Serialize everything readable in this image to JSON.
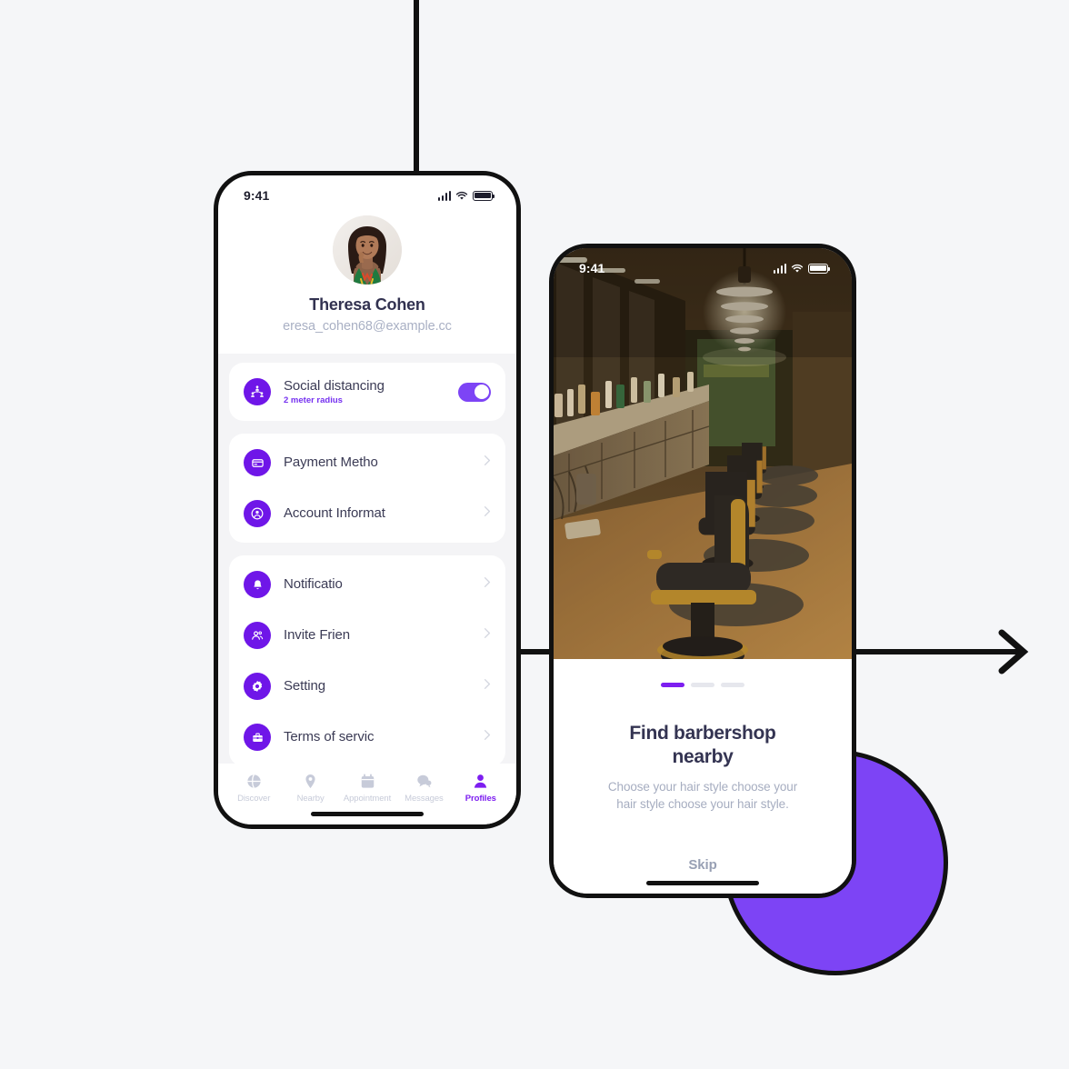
{
  "canvas": {
    "background": "#f5f6f8",
    "accent": "#7d44f5",
    "ink": "#111111"
  },
  "decor": {
    "vertical_line": "vertical-connector",
    "horizontal_line": "horizontal-connector",
    "arrow": "arrow-right-icon",
    "circle": "purple-circle-shape"
  },
  "phone_profile": {
    "status": {
      "time": "9:41",
      "signal": "signal-bars-icon",
      "wifi": "wifi-icon",
      "battery": "battery-full-icon"
    },
    "profile": {
      "avatar_alt": "user-avatar",
      "name": "Theresa Cohen",
      "email": "eresa_cohen68@example.cc"
    },
    "cards": [
      {
        "rows": [
          {
            "icon": "social-distancing-icon",
            "title": "Social distancing",
            "subtitle": "2 meter radius",
            "control": "toggle",
            "toggle_on": true
          }
        ]
      },
      {
        "rows": [
          {
            "icon": "credit-card-icon",
            "title": "Payment Metho",
            "control": "chevron"
          },
          {
            "icon": "account-circle-icon",
            "title": "Account Informat",
            "control": "chevron"
          }
        ]
      },
      {
        "rows": [
          {
            "icon": "bell-icon",
            "title": "Notificatio",
            "control": "chevron"
          },
          {
            "icon": "invite-friends-icon",
            "title": "Invite Frien",
            "control": "chevron"
          },
          {
            "icon": "gear-icon",
            "title": "Setting",
            "control": "chevron"
          },
          {
            "icon": "briefcase-icon",
            "title": "Terms of servic",
            "control": "chevron"
          }
        ]
      }
    ],
    "tabs": [
      {
        "icon": "globe-icon",
        "label": "Discover",
        "active": false
      },
      {
        "icon": "map-pin-icon",
        "label": "Nearby",
        "active": false
      },
      {
        "icon": "calendar-icon",
        "label": "Appointment",
        "active": false
      },
      {
        "icon": "chat-bubble-icon",
        "label": "Messages",
        "active": false
      },
      {
        "icon": "person-icon",
        "label": "Profiles",
        "active": true
      }
    ]
  },
  "phone_onboard": {
    "status": {
      "time": "9:41",
      "signal": "signal-bars-icon",
      "wifi": "wifi-icon",
      "battery": "battery-full-icon"
    },
    "hero_alt": "barbershop-interior-photo",
    "pagination": {
      "total": 3,
      "current": 1
    },
    "title": "Find barbershop nearby",
    "subtitle": "Choose your hair style choose your hair style choose your hair style.",
    "skip_label": "Skip"
  }
}
